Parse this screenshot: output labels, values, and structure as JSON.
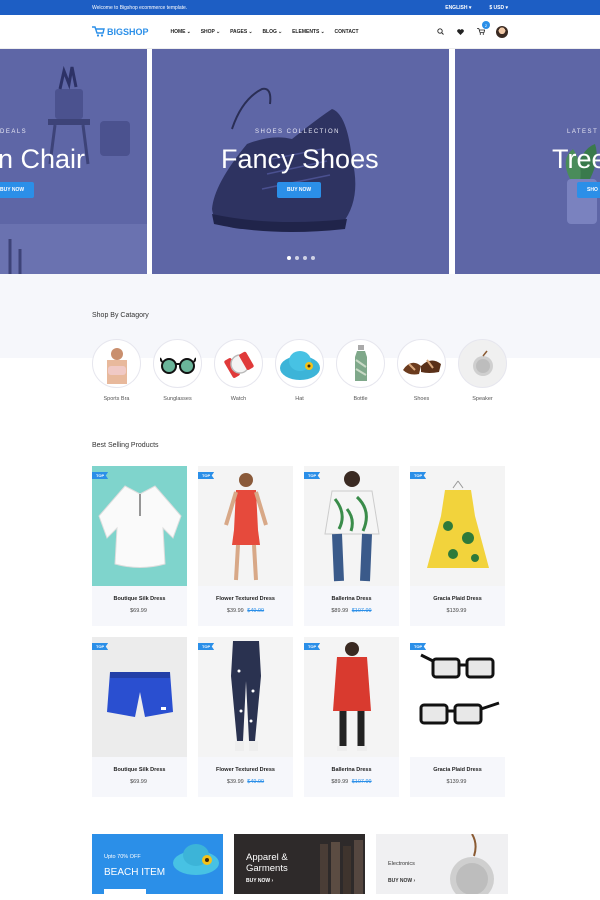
{
  "topbar": {
    "welcome": "Welcome to Bigshop ecommerce template.",
    "language": "ENGLISH ▾",
    "currency": "$ USD ▾"
  },
  "logo": {
    "text": "BIGSHOP"
  },
  "nav": [
    {
      "label": "HOME",
      "chevron": true
    },
    {
      "label": "SHOP",
      "chevron": true
    },
    {
      "label": "PAGES",
      "chevron": true
    },
    {
      "label": "BLOG",
      "chevron": true
    },
    {
      "label": "ELEMENTS",
      "chevron": true
    },
    {
      "label": "CONTACT",
      "chevron": false
    }
  ],
  "header": {
    "cart_count": "2"
  },
  "hero": {
    "left": {
      "sub": "DEALS",
      "title": "n Chair",
      "button": "BUY NOW"
    },
    "center": {
      "sub": "SHOES COLLECTION",
      "title": "Fancy Shoes",
      "button": "BUY NOW"
    },
    "right": {
      "sub": "LATEST",
      "title": "Tree",
      "button": "SHO"
    }
  },
  "categories": {
    "title": "Shop By Catagory",
    "items": [
      {
        "label": "Sports Bra",
        "icon": "sports-bra-icon"
      },
      {
        "label": "Sunglasses",
        "icon": "sunglasses-icon"
      },
      {
        "label": "Watch",
        "icon": "watch-icon"
      },
      {
        "label": "Hat",
        "icon": "hat-icon"
      },
      {
        "label": "Bottle",
        "icon": "bottle-icon"
      },
      {
        "label": "Shoes",
        "icon": "sandals-icon"
      },
      {
        "label": "Speaker",
        "icon": "speaker-icon"
      }
    ]
  },
  "best_selling": {
    "title": "Best Selling Products",
    "tag": "TOP",
    "products": [
      {
        "name": "Boutique Silk Dress",
        "price": "$69.99",
        "old_price": ""
      },
      {
        "name": "Flower Textured Dress",
        "price": "$39.99",
        "old_price": "$49.99"
      },
      {
        "name": "Ballerina Dress",
        "price": "$89.99",
        "old_price": "$107.99"
      },
      {
        "name": "Gracia Plaid Dress",
        "price": "$139.99",
        "old_price": ""
      },
      {
        "name": "Boutique Silk Dress",
        "price": "$69.99",
        "old_price": ""
      },
      {
        "name": "Flower Textured Dress",
        "price": "$39.99",
        "old_price": "$49.99"
      },
      {
        "name": "Ballerina Dress",
        "price": "$89.99",
        "old_price": "$107.99"
      },
      {
        "name": "Gracia Plaid Dress",
        "price": "$139.99",
        "old_price": ""
      }
    ]
  },
  "banners": [
    {
      "small": "Upto 70% OFF",
      "big": "BEACH ITEM",
      "link": ""
    },
    {
      "small": "",
      "big": "Apparel & Garments",
      "link": "BUY NOW ›"
    },
    {
      "small": "Electronics",
      "big": "",
      "link": "BUY NOW ›"
    }
  ],
  "colors": {
    "primary": "#2b8fe8",
    "hero": "#5e66a6",
    "light_bg": "#f6f7fb"
  }
}
